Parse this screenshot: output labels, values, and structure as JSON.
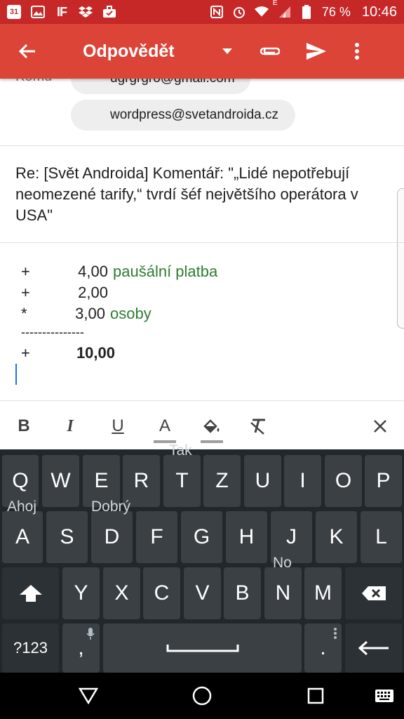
{
  "status_bar": {
    "battery_percent": "76 %",
    "time": "10:46",
    "left_icons": [
      "calendar-icon",
      "image-icon",
      "ifttt-icon",
      "dropbox-icon",
      "briefcase-icon"
    ],
    "calendar_day": "31",
    "ifttt_label": "IF",
    "right_icons": [
      "nfc-icon",
      "alarm-icon",
      "wifi-icon",
      "signal-icon",
      "battery-icon"
    ],
    "network_label": "E"
  },
  "app_bar": {
    "title": "Odpovědět",
    "color": "#db4437"
  },
  "recipients": {
    "label": "Komu",
    "chips": [
      "ugrgrgro@gmail.com",
      "wordpress@svetandroida.cz"
    ]
  },
  "subject": "Re: [Svět Androida] Komentář: \"„Lidé nepotřebují neomezené tarify,“ tvrdí šéf největšího operátora v USA\"",
  "body": {
    "rows": [
      {
        "op": "+",
        "num": "4,00",
        "label": "paušální platba"
      },
      {
        "op": "+",
        "num": "2,00",
        "label": ""
      },
      {
        "op": "*",
        "num": "3,00",
        "label": "osoby"
      }
    ],
    "separator": "---------------",
    "total": {
      "op": "+",
      "num": "10,00"
    },
    "label_color": "#2e7d32"
  },
  "format_toolbar": {
    "bold": "B",
    "italic": "I",
    "underline": "U",
    "text_color": "A"
  },
  "keyboard": {
    "row1": [
      "Q",
      "W",
      "E",
      "R",
      "T",
      "Z",
      "U",
      "I",
      "O",
      "P"
    ],
    "row2": [
      "A",
      "S",
      "D",
      "F",
      "G",
      "H",
      "J",
      "K",
      "L"
    ],
    "row3": [
      "Y",
      "X",
      "C",
      "V",
      "B",
      "N",
      "M"
    ],
    "symbols_key": "?123",
    "comma_key": ",",
    "period_key": ".",
    "suggestions": {
      "tak": "Tak",
      "ahoj": "Ahoj",
      "dobry": "Dobrý",
      "no": "No"
    }
  }
}
